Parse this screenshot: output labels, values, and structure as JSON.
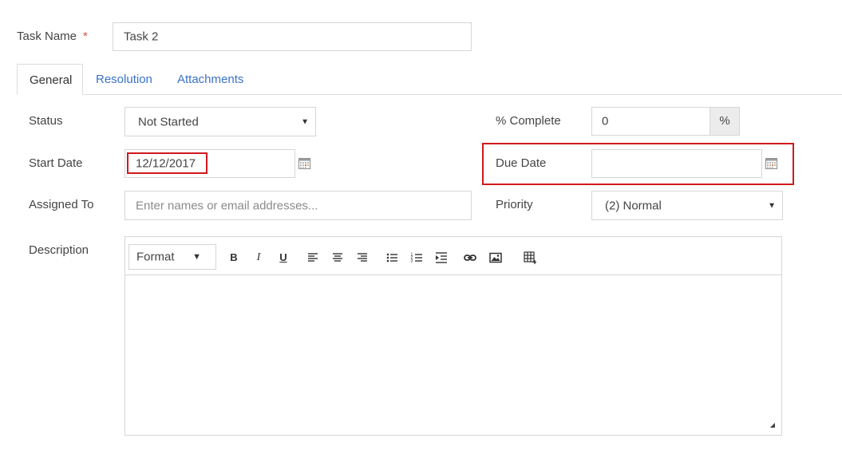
{
  "task_name": {
    "label": "Task Name",
    "required_mark": "*",
    "value": "Task 2"
  },
  "tabs": [
    {
      "label": "General",
      "active": true
    },
    {
      "label": "Resolution",
      "active": false
    },
    {
      "label": "Attachments",
      "active": false
    }
  ],
  "status": {
    "label": "Status",
    "value": "Not Started"
  },
  "percent_complete": {
    "label": "% Complete",
    "value": "0",
    "addon": "%"
  },
  "start_date": {
    "label": "Start Date",
    "value": "12/12/2017"
  },
  "due_date": {
    "label": "Due Date",
    "value": ""
  },
  "assigned_to": {
    "label": "Assigned To",
    "placeholder": "Enter names or email addresses..."
  },
  "priority": {
    "label": "Priority",
    "value": "(2) Normal"
  },
  "description": {
    "label": "Description",
    "toolbar": {
      "format_label": "Format",
      "bold": "B",
      "italic": "I",
      "underline": "U",
      "icons": [
        "align-left-icon",
        "align-center-icon",
        "align-right-icon",
        "bullet-list-icon",
        "numbered-list-icon",
        "indent-icon",
        "link-icon",
        "image-icon",
        "table-icon"
      ]
    },
    "value": ""
  },
  "colors": {
    "accent": "#3a72c9",
    "highlight": "#d0191e",
    "required": "#d9534f"
  }
}
